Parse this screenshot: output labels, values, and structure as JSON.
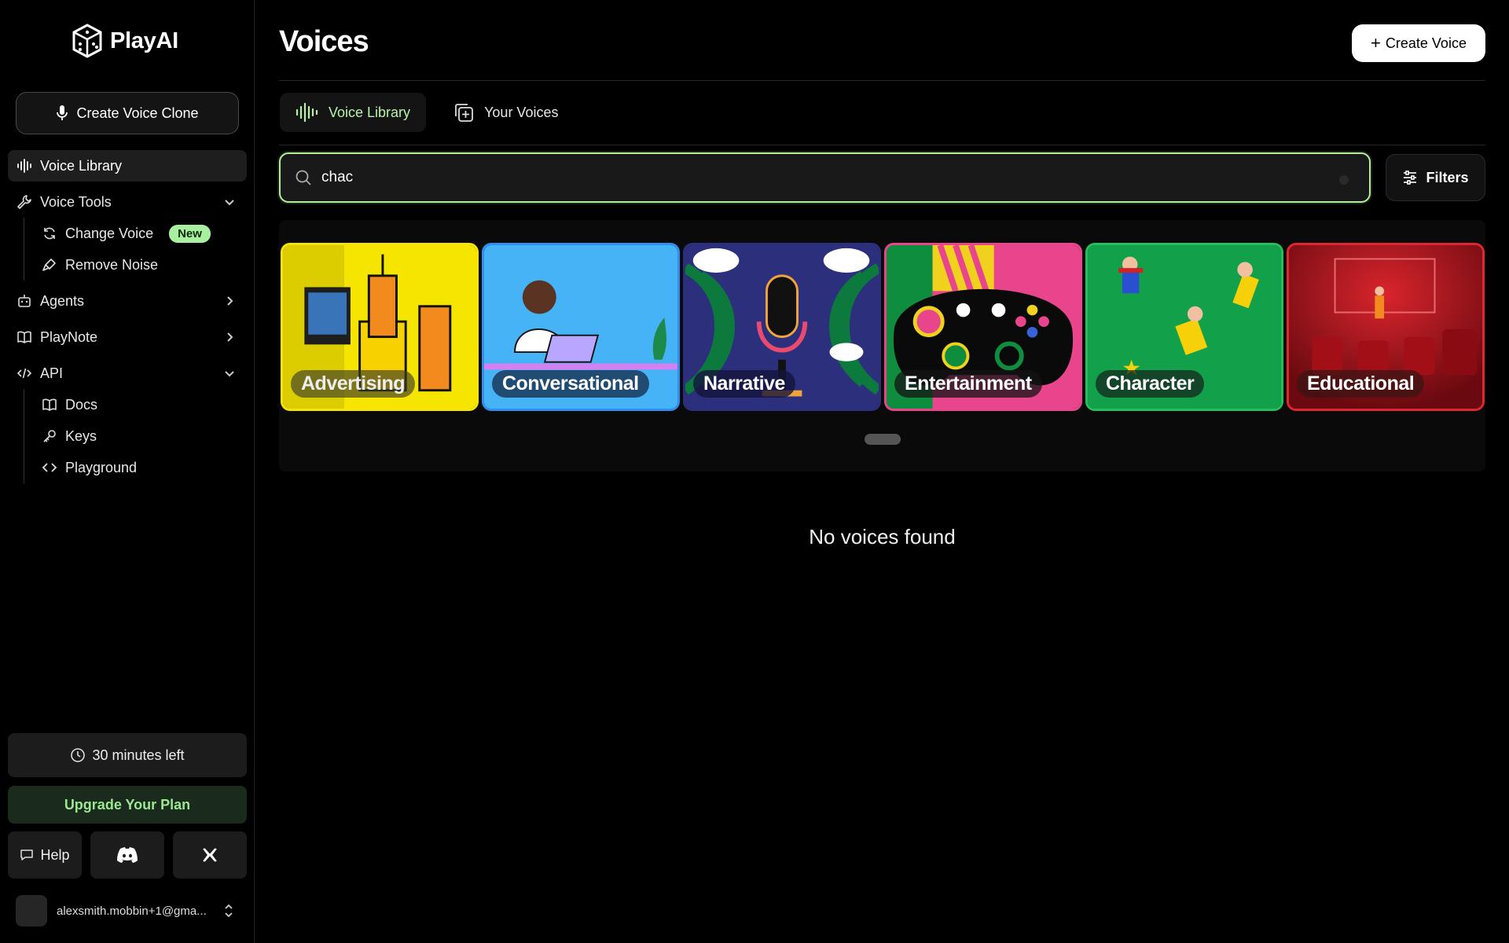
{
  "brand": {
    "name": "PlayAI"
  },
  "sidebar": {
    "clone_button": "Create Voice Clone",
    "nav": {
      "voice_library": "Voice Library",
      "voice_tools": "Voice Tools",
      "change_voice": "Change Voice",
      "new_badge": "New",
      "remove_noise": "Remove Noise",
      "agents": "Agents",
      "playnote": "PlayNote",
      "api": "API",
      "docs": "Docs",
      "keys": "Keys",
      "playground": "Playground"
    },
    "minutes_left": "30 minutes left",
    "upgrade": "Upgrade Your Plan",
    "help": "Help",
    "account_email": "alexsmith.mobbin+1@gma..."
  },
  "main": {
    "title": "Voices",
    "create_voice": "Create Voice",
    "tabs": [
      "Voice Library",
      "Your Voices"
    ],
    "search": {
      "value": "chac"
    },
    "filters": "Filters",
    "categories": [
      "Advertising",
      "Conversational",
      "Narrative",
      "Entertainment",
      "Character",
      "Educational"
    ],
    "empty_message": "No voices found"
  },
  "colors": {
    "accent_green": "#b4ec9e",
    "advertising_bg": "#f6e500",
    "conversational_bg": "#46b3f7",
    "narrative_bg": "#2b2f7c",
    "entertainment_bg": "#e8458c",
    "character_bg": "#12a14a",
    "educational_bg": "#c8161e"
  }
}
